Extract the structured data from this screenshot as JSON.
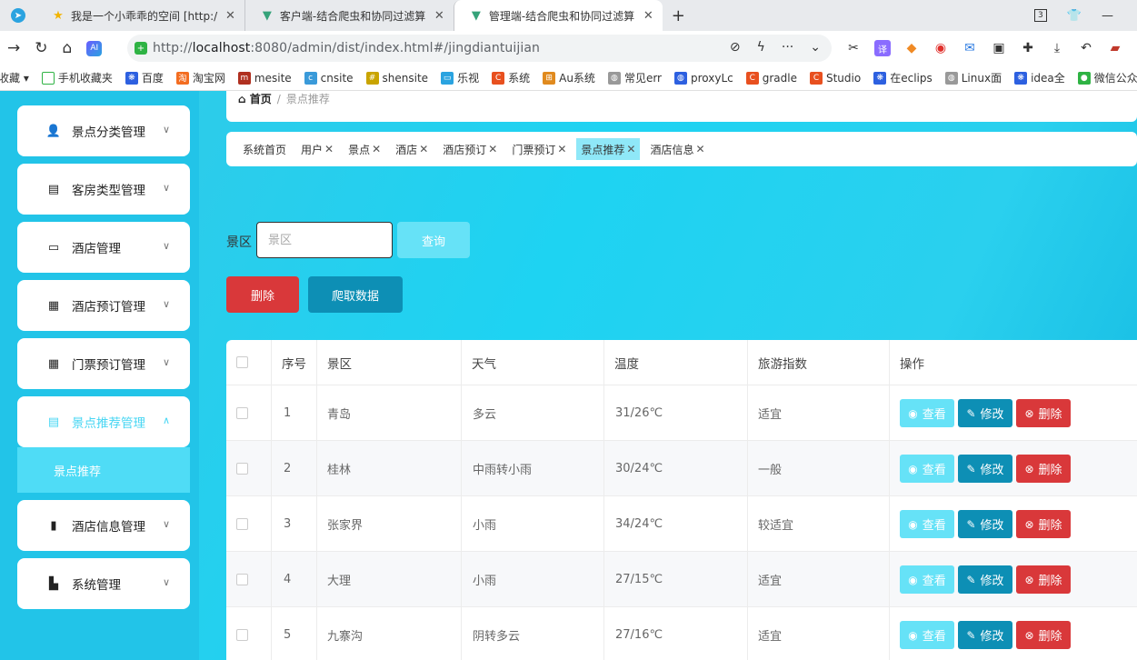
{
  "browser": {
    "tabs": [
      {
        "title": "我是一个小乖乖的空间 [http:/",
        "favicon": "star-icon",
        "active": false
      },
      {
        "title": "客户端-结合爬虫和协同过滤算",
        "favicon": "vue-icon",
        "active": false
      },
      {
        "title": "管理端-结合爬虫和协同过滤算",
        "favicon": "vue-icon",
        "active": true
      }
    ],
    "tab_count": "3",
    "url_prefix": "http://",
    "url_host": "localhost",
    "url_rest": ":8080/admin/dist/index.html#/jingdiantuijian",
    "bookmarks": [
      "收藏",
      "手机收藏夹",
      "百度",
      "淘宝网",
      "mesite",
      "cnsite",
      "shensite",
      "乐视",
      "系统",
      "Au系统",
      "常见err",
      "proxyLc",
      "gradle",
      "Studio",
      "在eclips",
      "Linux面",
      "idea全",
      "微信公众"
    ]
  },
  "sidebar": {
    "items": [
      {
        "label": "景点分类管理",
        "icon": "user-icon"
      },
      {
        "label": "客房类型管理",
        "icon": "clipboard-icon"
      },
      {
        "label": "酒店管理",
        "icon": "monitor-icon"
      },
      {
        "label": "酒店预订管理",
        "icon": "grid-icon"
      },
      {
        "label": "门票预订管理",
        "icon": "grid-icon"
      },
      {
        "label": "景点推荐管理",
        "icon": "clipboard-icon"
      },
      {
        "label": "酒店信息管理",
        "icon": "bar-chart-icon"
      },
      {
        "label": "系统管理",
        "icon": "book-icon"
      }
    ],
    "submenu_label": "景点推荐"
  },
  "breadcrumb": {
    "home": "首页",
    "separator": "/",
    "current": "景点推荐"
  },
  "tags": [
    "系统首页",
    "用户",
    "景点",
    "酒店",
    "酒店预订",
    "门票预订",
    "景点推荐",
    "酒店信息"
  ],
  "search": {
    "label": "景区",
    "placeholder": "景区",
    "query_label": "查询"
  },
  "actions": {
    "delete_label": "删除",
    "crawl_label": "爬取数据"
  },
  "table": {
    "headers": [
      "序号",
      "景区",
      "天气",
      "温度",
      "旅游指数",
      "操作"
    ],
    "rows": [
      {
        "no": "1",
        "area": "青岛",
        "weather": "多云",
        "temp": "31/26℃",
        "index": "适宜"
      },
      {
        "no": "2",
        "area": "桂林",
        "weather": "中雨转小雨",
        "temp": "30/24℃",
        "index": "一般"
      },
      {
        "no": "3",
        "area": "张家界",
        "weather": "小雨",
        "temp": "34/24℃",
        "index": "较适宜"
      },
      {
        "no": "4",
        "area": "大理",
        "weather": "小雨",
        "temp": "27/15℃",
        "index": "适宜"
      },
      {
        "no": "5",
        "area": "九寨沟",
        "weather": "阴转多云",
        "temp": "27/16℃",
        "index": "适宜"
      }
    ],
    "row_actions": {
      "view": "查看",
      "edit": "修改",
      "delete": "删除"
    }
  },
  "colors": {
    "accent": "#22c4e8",
    "danger": "#d9383a",
    "primary_dark": "#0d8fb5",
    "light_accent": "#66e2f7"
  }
}
